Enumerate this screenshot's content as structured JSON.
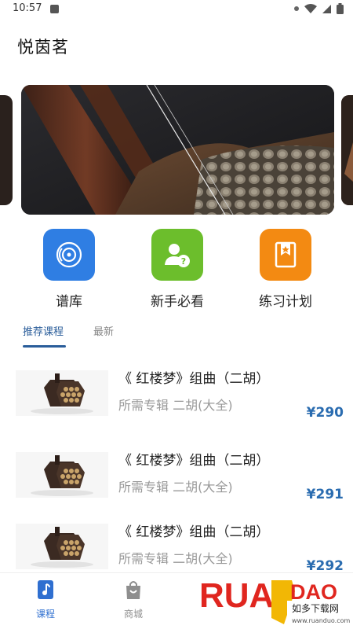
{
  "status_bar": {
    "time": "10:57"
  },
  "app": {
    "title": "悦茵茗"
  },
  "quick_links": [
    {
      "label": "谱库",
      "icon": "disc-icon",
      "color": "#2f7ee3"
    },
    {
      "label": "新手必看",
      "icon": "user-question-icon",
      "color": "#6cbe2c"
    },
    {
      "label": "练习计划",
      "icon": "bookmark-star-icon",
      "color": "#f38a12"
    }
  ],
  "tabs": {
    "recommended": "推荐课程",
    "latest": "最新"
  },
  "courses": [
    {
      "title": "《 红楼梦》组曲（二胡）",
      "subtitle": "所需专辑 二胡(大全)",
      "price": "¥290"
    },
    {
      "title": "《 红楼梦》组曲（二胡）",
      "subtitle": "所需专辑 二胡(大全)",
      "price": "¥291"
    },
    {
      "title": "《 红楼梦》组曲（二胡）",
      "subtitle": "所需专辑 二胡(大全)",
      "price": "¥292"
    }
  ],
  "bottom_nav": [
    {
      "label": "课程",
      "icon": "music-note-icon",
      "active": true
    },
    {
      "label": "商城",
      "icon": "shopping-bag-icon",
      "active": false
    }
  ],
  "watermark": {
    "brand": "RUANDAO",
    "tagline": "如多下载网",
    "url": "www.ruanduo.com"
  },
  "colors": {
    "accent": "#2a5d9a",
    "price": "#2a6cb0",
    "nav_active": "#2f6fd0"
  }
}
